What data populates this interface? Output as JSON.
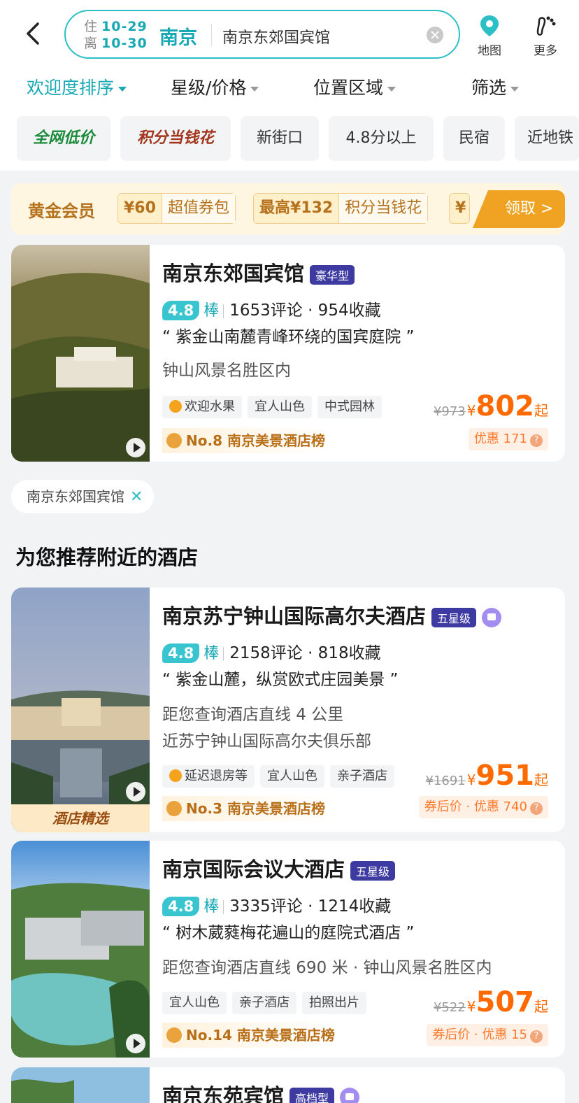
{
  "search": {
    "checkin_label": "住",
    "checkin_date": "10-29",
    "checkout_label": "离",
    "checkout_date": "10-30",
    "city": "南京",
    "keyword": "南京东郊国宾馆",
    "map_label": "地图",
    "more_label": "更多"
  },
  "sort_tabs": [
    "欢迎度排序",
    "星级/价格",
    "位置区域",
    "筛选"
  ],
  "quick_filters": [
    "全网低价",
    "积分当钱花",
    "新街口",
    "4.8分以上",
    "民宿",
    "近地铁"
  ],
  "gold_banner": {
    "title": "黄金会员",
    "offers": [
      {
        "amount": "¥60",
        "text": "超值券包"
      },
      {
        "amount": "最高¥132",
        "text": "积分当钱花"
      },
      {
        "amount": "¥",
        "text": ""
      }
    ],
    "claim": "领取 >"
  },
  "primary_hotel": {
    "name": "南京东郊国宾馆",
    "grade": "豪华型",
    "score": "4.8",
    "score_word": "棒",
    "stats": "1653评论 · 954收藏",
    "quote": "“ 紫金山南麓青峰环绕的国宾庭院 ”",
    "desc": "钟山风景名胜区内",
    "tags": [
      "欢迎水果",
      "宜人山色",
      "中式园林"
    ],
    "rank": "No.8 南京美景酒店榜",
    "old_price": "¥973",
    "yen": "¥",
    "price": "802",
    "qi": "起",
    "discount": "优惠 171"
  },
  "active_filter": "南京东郊国宾馆",
  "section_title": "为您推荐附近的酒店",
  "recommended": [
    {
      "name": "南京苏宁钟山国际高尔夫酒店",
      "grade": "五星级",
      "score": "4.8",
      "score_word": "棒",
      "stats": "2158评论 · 818收藏",
      "quote": "“ 紫金山麓，纵赏欧式庄园美景 ”",
      "desc1": "距您查询酒店直线 4 公里",
      "desc2": "近苏宁钟山国际高尔夫俱乐部",
      "tags": [
        "延迟退房等",
        "宜人山色",
        "亲子酒店"
      ],
      "rank": "No.3 南京美景酒店榜",
      "old_price": "¥1691",
      "yen": "¥",
      "price": "951",
      "qi": "起",
      "discount": "券后价 · 优惠 740",
      "photo_tag": "酒店精选"
    },
    {
      "name": "南京国际会议大酒店",
      "grade": "五星级",
      "score": "4.8",
      "score_word": "棒",
      "stats": "3335评论 · 1214收藏",
      "quote": "“ 树木葳蕤梅花遍山的庭院式酒店 ”",
      "desc1": "距您查询酒店直线 690 米 · 钟山风景名胜区内",
      "tags": [
        "宜人山色",
        "亲子酒店",
        "拍照出片"
      ],
      "rank": "No.14 南京美景酒店榜",
      "old_price": "¥522",
      "yen": "¥",
      "price": "507",
      "qi": "起",
      "discount": "券后价 · 优惠 15"
    },
    {
      "name": "南京东苑宾馆",
      "grade": "高档型"
    }
  ],
  "colors": {
    "accent": "#16a9b5",
    "price": "#ff6a00",
    "gold": "#b5711b"
  }
}
